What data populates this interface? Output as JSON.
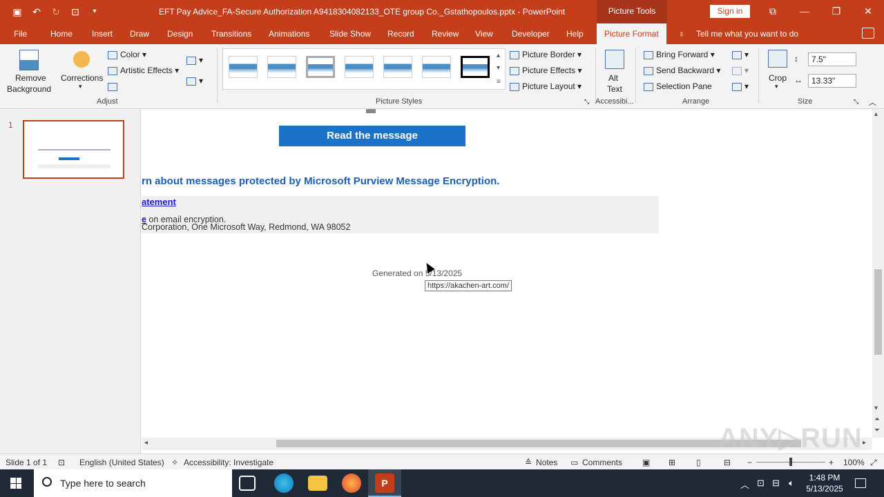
{
  "titlebar": {
    "doc_title": "EFT Pay Advice_FA-Secure Authorization A9418304082133_OTE group Co._Gstathopoulos.pptx  -  PowerPoint",
    "context_tab_group": "Picture Tools",
    "sign_in": "Sign in"
  },
  "tabs": {
    "file": "File",
    "home": "Home",
    "insert": "Insert",
    "draw": "Draw",
    "design": "Design",
    "transitions": "Transitions",
    "animations": "Animations",
    "slideshow": "Slide Show",
    "record": "Record",
    "review": "Review",
    "view": "View",
    "developer": "Developer",
    "help": "Help",
    "picture_format": "Picture Format",
    "tell_me": "Tell me what you want to do"
  },
  "ribbon": {
    "adjust": {
      "remove_bg_1": "Remove",
      "remove_bg_2": "Background",
      "corrections": "Corrections",
      "color": "Color",
      "artistic": "Artistic Effects",
      "label": "Adjust"
    },
    "styles": {
      "label": "Picture Styles"
    },
    "picture_opts": {
      "border": "Picture Border",
      "effects": "Picture Effects",
      "layout": "Picture Layout"
    },
    "accessibility": {
      "alt_1": "Alt",
      "alt_2": "Text",
      "label": "Accessibi..."
    },
    "arrange": {
      "forward": "Bring Forward",
      "backward": "Send Backward",
      "pane": "Selection Pane",
      "label": "Arrange"
    },
    "size": {
      "crop": "Crop",
      "height": "7.5\"",
      "width": "13.33\"",
      "label": "Size"
    }
  },
  "thumbs": {
    "slide_number": "1"
  },
  "slide": {
    "read_button": "Read the message",
    "learn_text": "rn about messages protected by Microsoft Purview Message Encryption.",
    "statement": "atement",
    "enc_link": "e",
    "enc_rest": " on email encryption.",
    "corp": "Corporation, One Microsoft Way, Redmond, WA 98052",
    "generated": "Generated  on 5/13/2025",
    "tooltip": "https://akachen-art.com/"
  },
  "statusbar": {
    "slide": "Slide 1 of 1",
    "language": "English (United States)",
    "accessibility": "Accessibility: Investigate",
    "notes": "Notes",
    "comments": "Comments",
    "zoom": "100%"
  },
  "taskbar": {
    "search_placeholder": "Type here to search",
    "time": "1:48 PM",
    "date": "5/13/2025"
  },
  "colors": {
    "accent": "#c43e1c",
    "button_blue": "#1a73c6"
  }
}
